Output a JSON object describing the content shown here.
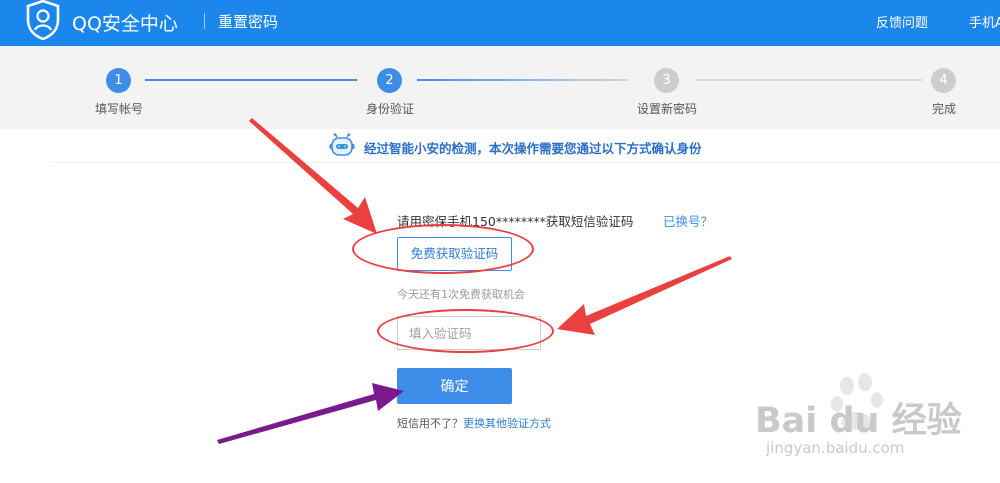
{
  "header": {
    "brand": "QQ安全中心",
    "subtitle": "重置密码",
    "nav": {
      "feedback": "反馈问题",
      "mobile": "手机A"
    },
    "background_color": "#1b86ec"
  },
  "steps": {
    "items": [
      {
        "number": "1",
        "label": "填写帐号",
        "state": "done"
      },
      {
        "number": "2",
        "label": "身份验证",
        "state": "active"
      },
      {
        "number": "3",
        "label": "设置新密码",
        "state": "pending"
      },
      {
        "number": "4",
        "label": "完成",
        "state": "pending"
      }
    ],
    "active_color": "#3e8ee9",
    "inactive_color": "#cdcdcd"
  },
  "notice": {
    "icon": "robot-icon",
    "text": "经过智能小安的检测，本次操作需要您通过以下方式确认身份"
  },
  "form": {
    "phone_message": "请用密保手机150********获取短信验证码",
    "changed_number_link": "已换号？",
    "get_code_button": "免费获取验证码",
    "free_tip": "今天还有1次免费获取机会",
    "code_input": {
      "value": "",
      "placeholder": "填入验证码"
    },
    "confirm_button": "确定",
    "sms_unavailable_text": "短信用不了？",
    "other_methods_link": "更换其他验证方式"
  },
  "annotations": {
    "arrow_colors": [
      "#e8413f",
      "#e8413f",
      "#7b1a8c"
    ]
  },
  "watermark": {
    "logo_text": "Bai du 经验",
    "url": "jingyan.baidu.com"
  }
}
